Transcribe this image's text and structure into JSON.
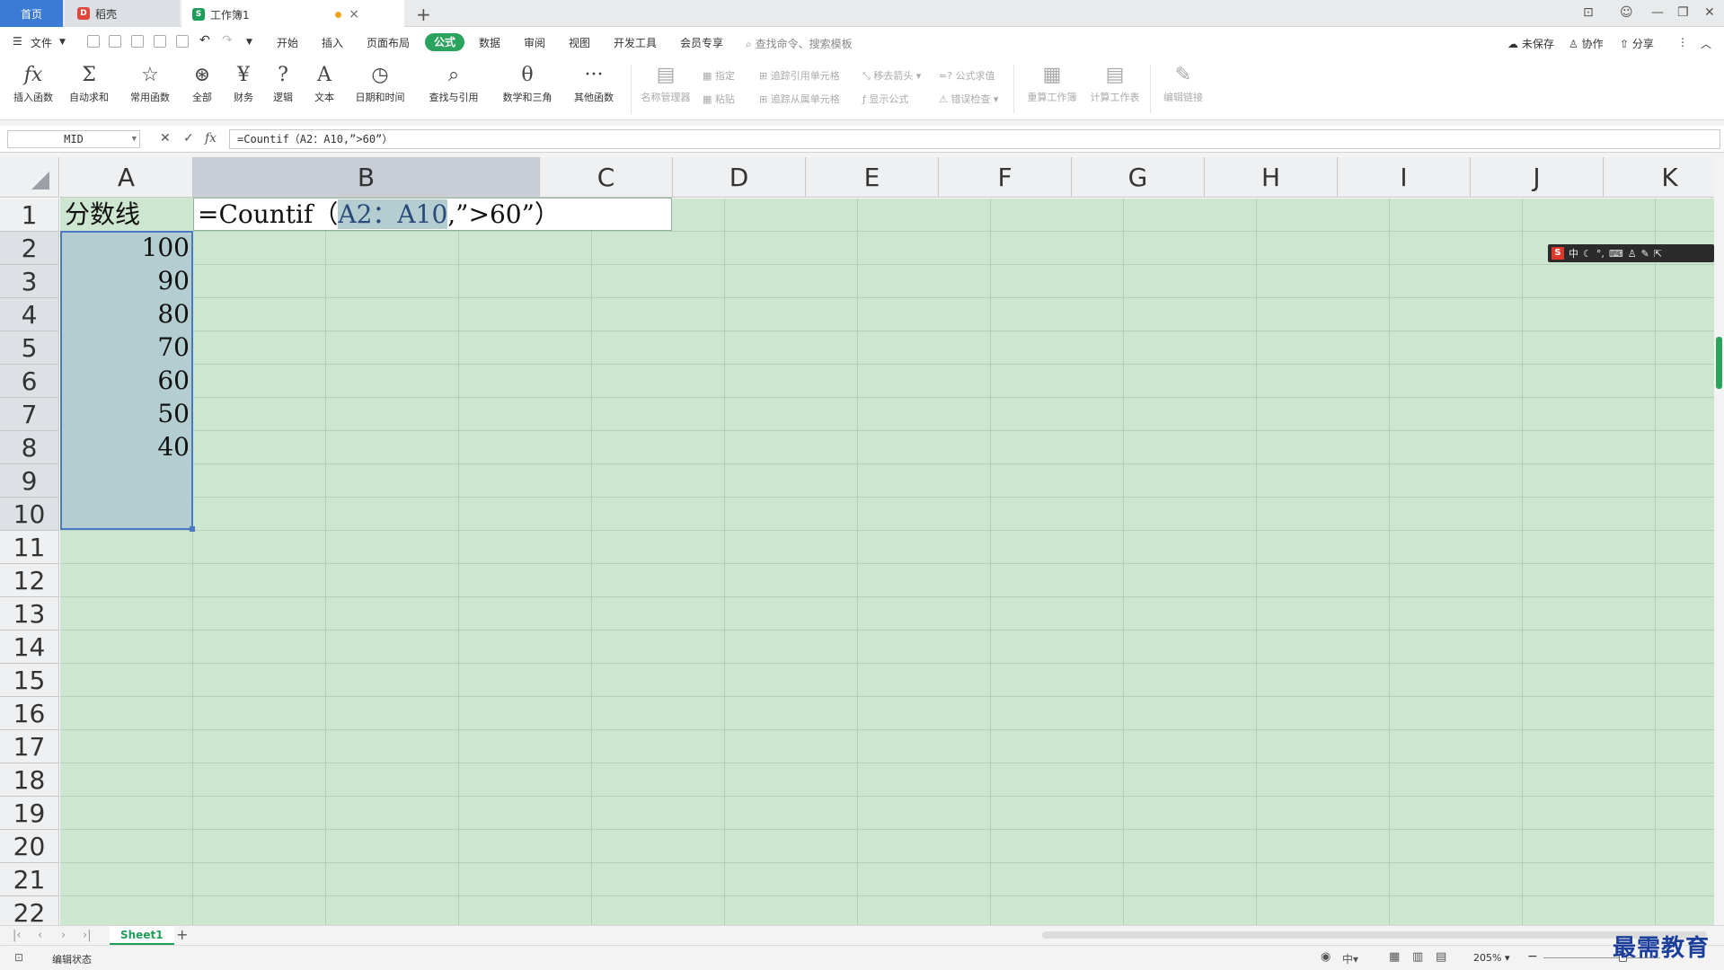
{
  "tabs": {
    "home": "首页",
    "docer": "稻壳",
    "workbook": "工作簿1"
  },
  "quick_search": {
    "placeholder": "查找命令、搜索模板"
  },
  "menu": {
    "file": "文件",
    "items": [
      "开始",
      "插入",
      "页面布局",
      "公式",
      "数据",
      "审阅",
      "视图",
      "开发工具",
      "会员专享"
    ],
    "active": "公式",
    "unsaved": "未保存",
    "collaborate": "协作",
    "share": "分享"
  },
  "ribbon": {
    "insert_function": "插入函数",
    "autosum": "自动求和",
    "common_functions": "常用函数",
    "all": "全部",
    "finance": "财务",
    "logic": "逻辑",
    "text": "文本",
    "datetime": "日期和时间",
    "lookup": "查找与引用",
    "math": "数学和三角",
    "other": "其他函数",
    "name_manager": "名称管理器",
    "specify": "指定",
    "paste": "粘贴",
    "trace_precedents": "追踪引用单元格",
    "trace_dependents": "追踪从属单元格",
    "remove_arrows": "移去箭头",
    "evaluate_formula": "公式求值",
    "show_formulas": "显示公式",
    "error_check": "错误检查",
    "recalc_workbook": "重算工作簿",
    "calc_sheet": "计算工作表",
    "edit_links": "编辑链接"
  },
  "formula_bar": {
    "name_box": "MID",
    "formula": "=Countif（A2：A10,”>60”）"
  },
  "grid": {
    "columns": [
      "A",
      "B",
      "C",
      "D",
      "E",
      "F",
      "G",
      "H",
      "I",
      "J",
      "K"
    ],
    "rows": [
      "1",
      "2",
      "3",
      "4",
      "5",
      "6",
      "7",
      "8",
      "9",
      "10",
      "11",
      "12",
      "13",
      "14",
      "15",
      "16",
      "17",
      "18",
      "19",
      "20",
      "21",
      "22"
    ],
    "a1": "分数线",
    "a_values": [
      "100",
      "90",
      "80",
      "70",
      "60",
      "50",
      "40"
    ],
    "edit_prefix": "=Countif（",
    "edit_ref": "A2：A10",
    "edit_suffix": ",”>60”）"
  },
  "ime": {
    "logo": "S",
    "mode": "中"
  },
  "sheets": {
    "active": "Sheet1",
    "add": "+"
  },
  "status": {
    "state": "编辑状态",
    "zoom": "205%"
  },
  "watermark": "最需教育"
}
